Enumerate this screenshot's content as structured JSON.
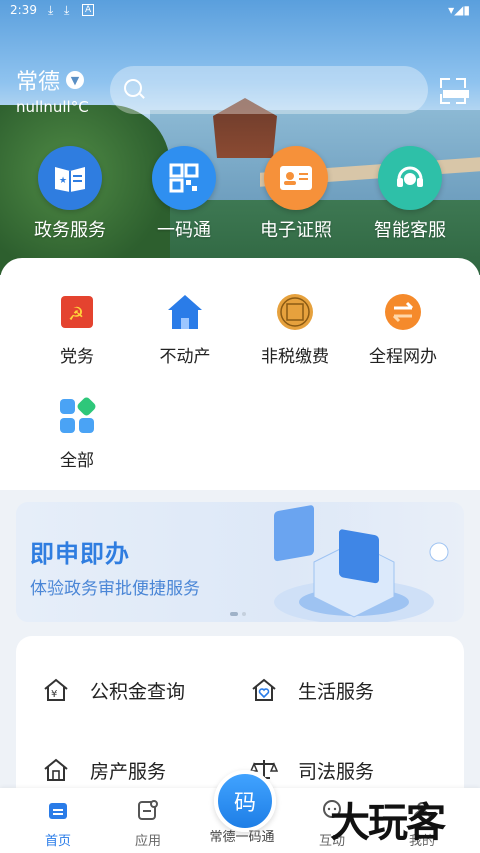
{
  "status_bar": {
    "time": "2:39",
    "download1": "⤓",
    "download2": "⤓",
    "a_icon": "A",
    "right": "▾◢▮"
  },
  "header": {
    "city": "常德",
    "weather": "nullnull°C"
  },
  "quick_actions": [
    {
      "label": "政务服务",
      "color": "#2f7de0",
      "icon": "book-icon"
    },
    {
      "label": "一码通",
      "color": "#2f8ff0",
      "icon": "qrcode-icon"
    },
    {
      "label": "电子证照",
      "color": "#f6913a",
      "icon": "id-card-icon"
    },
    {
      "label": "智能客服",
      "color": "#2ec0a8",
      "icon": "headset-icon"
    }
  ],
  "services": [
    {
      "label": "党务",
      "icon": "party-flag-icon"
    },
    {
      "label": "不动产",
      "icon": "house-icon"
    },
    {
      "label": "非税缴费",
      "icon": "coin-seal-icon"
    },
    {
      "label": "全程网办",
      "icon": "exchange-icon"
    },
    {
      "label": "全部",
      "icon": "grid-icon"
    }
  ],
  "banner": {
    "title": "即申即办",
    "subtitle": "体验政务审批便捷服务"
  },
  "featured": [
    {
      "label": "公积金查询",
      "icon": "fund-house-icon"
    },
    {
      "label": "生活服务",
      "icon": "heart-house-icon"
    },
    {
      "label": "房产服务",
      "icon": "property-icon"
    },
    {
      "label": "司法服务",
      "icon": "justice-icon"
    }
  ],
  "tabbar": {
    "home": "首页",
    "apps": "应用",
    "center": "常德一码通",
    "center_glyph": "码",
    "interact": "互动",
    "mine": "我的"
  },
  "watermark": "大玩客",
  "accent_color": "#2a7ce8"
}
